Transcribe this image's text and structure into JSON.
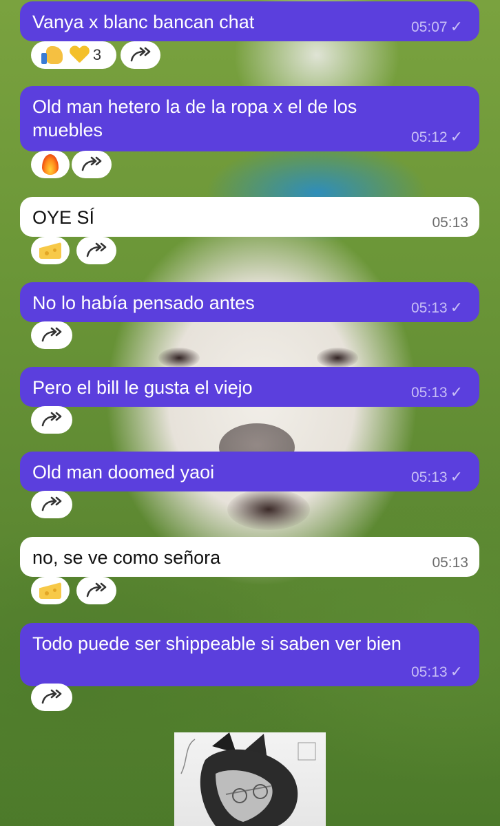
{
  "colors": {
    "outgoing_bubble": "#5b3fdd",
    "incoming_bubble": "#ffffff",
    "reaction_pill": "#ffffff"
  },
  "messages": [
    {
      "text": "Vanya x blanc bancan chat",
      "time": "05:07",
      "type": "out",
      "reactions": [
        {
          "icon": "thumbs-up-icon"
        },
        {
          "icon": "yellow-heart-icon"
        }
      ],
      "reaction_count": "3"
    },
    {
      "text": "Old man hetero la de la ropa x el de los muebles",
      "time": "05:12",
      "type": "out",
      "reactions": [
        {
          "icon": "fire-icon"
        }
      ]
    },
    {
      "text": "OYE SÍ",
      "time": "05:13",
      "type": "in",
      "reactions": [
        {
          "icon": "cheese-icon"
        }
      ]
    },
    {
      "text": "No lo había pensado antes",
      "time": "05:13",
      "type": "out",
      "reactions": []
    },
    {
      "text": "Pero el bill le gusta el viejo",
      "time": "05:13",
      "type": "out",
      "reactions": []
    },
    {
      "text": "Old man doomed yaoi",
      "time": "05:13",
      "type": "out",
      "reactions": []
    },
    {
      "text": "no, se ve como señora",
      "time": "05:13",
      "type": "in",
      "reactions": [
        {
          "icon": "cheese-icon"
        }
      ]
    },
    {
      "text": "Todo puede ser shippeable si saben ver bien",
      "time": "05:13",
      "type": "out",
      "reactions": []
    }
  ],
  "status_icons": {
    "read": "check-icon",
    "forward": "forward-icon"
  }
}
